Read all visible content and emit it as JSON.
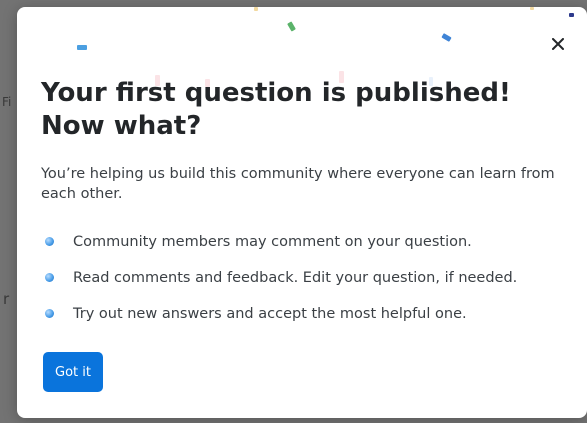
{
  "background": {
    "fragments": [
      "Fi",
      "r"
    ]
  },
  "dialog": {
    "close_icon": "close-icon",
    "title_line1": "Your first question is published!",
    "title_line2": "Now what?",
    "lead": "You’re helping us build this community where everyone can learn from each other.",
    "bullets": [
      "Community members may comment on your question.",
      "Read comments and feedback. Edit your question, if needed.",
      "Try out new answers and accept the most helpful one."
    ],
    "button_label": "Got it"
  },
  "colors": {
    "primary": "#0a74dc",
    "overlay": "#737373",
    "text": "#232629"
  }
}
